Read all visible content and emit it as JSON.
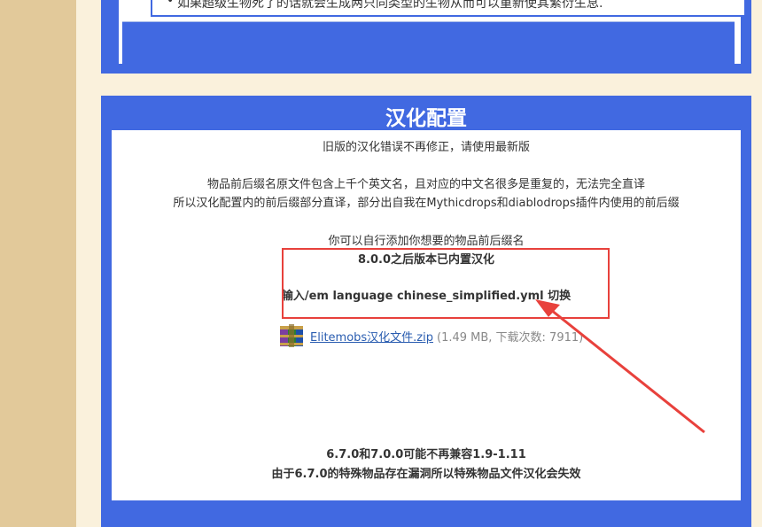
{
  "top_section": {
    "list_item": "如果超级生物死了的话就会生成两只同类型的生物从而可以重新使其繁衍生息."
  },
  "main_section": {
    "title": "汉化配置",
    "line1": "旧版的汉化错误不再修正，请使用最新版",
    "line2": "物品前后缀名原文件包含上千个英文名，且对应的中文名很多是重复的，无法完全直译",
    "line3": "所以汉化配置内的前后缀部分直译，部分出自我在Mythicdrops和diablodrops插件内使用的前后缀",
    "line4": "你可以自行添加你想要的物品前后缀名",
    "highlight_line1": "8.0.0之后版本已内置汉化",
    "highlight_line2": "输入/em language chinese_simplified.yml 切换",
    "download": {
      "icon": "winrar-archive-icon",
      "filename": "Elitemobs汉化文件.zip",
      "meta": "(1.49 MB, 下载次数: 7911)"
    },
    "note1": "6.7.0和7.0.0可能不再兼容1.9-1.11",
    "note2": "由于6.7.0的特殊物品存在漏洞所以特殊物品文件汉化会失效"
  },
  "colors": {
    "accent_blue": "#4169e1",
    "annotation_red": "#e8413c",
    "page_bg": "#faf1dc",
    "side_bg": "#e2c99a"
  }
}
